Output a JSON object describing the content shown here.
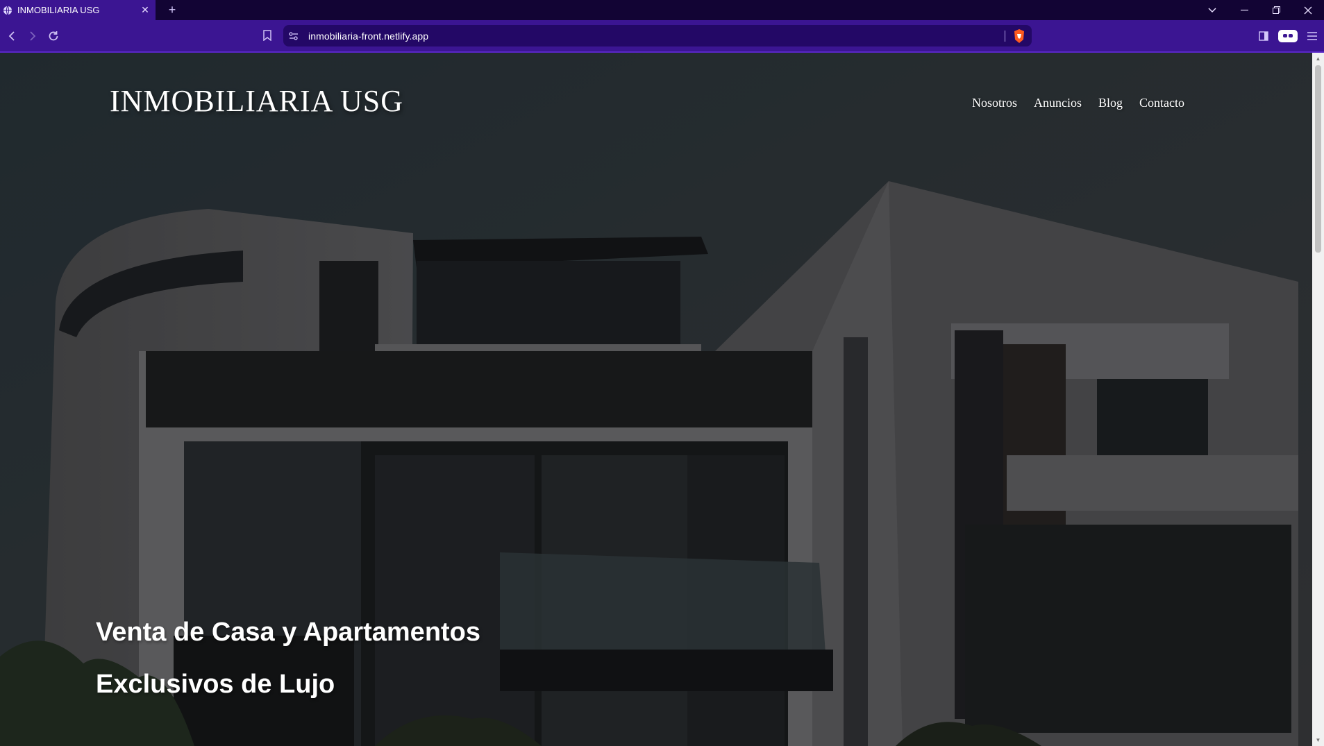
{
  "browser": {
    "tab": {
      "title": "INMOBILIARIA USG",
      "close": "✕"
    },
    "new_tab": "+",
    "window_controls": {
      "tabs_menu": "⌄",
      "minimize": "—",
      "restore": "❐",
      "close": "✕"
    },
    "url": "inmobiliaria-front.netlify.app",
    "accent_color": "#3b1592"
  },
  "site": {
    "logo": "INMOBILIARIA USG",
    "nav": [
      "Nosotros",
      "Anuncios",
      "Blog",
      "Contacto"
    ],
    "hero": {
      "line1": "Venta de Casa y Apartamentos",
      "line2": "Exclusivos de Lujo"
    }
  }
}
